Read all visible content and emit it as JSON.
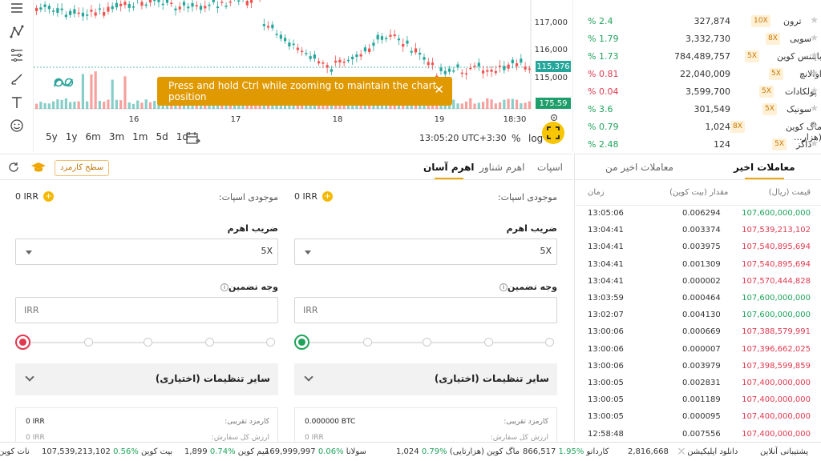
{
  "chart": {
    "y_ticks": [
      "117,000",
      "116,000",
      "115,000"
    ],
    "x_ticks": [
      "16",
      "17",
      "18",
      "19",
      "18:30"
    ],
    "last_price": "115,376",
    "volume_value": "175.59",
    "toast": "Press and hold Ctrl while zooming to maintain the chart position",
    "toast_close": "✕",
    "timeframes": [
      "5y",
      "1y",
      "6m",
      "3m",
      "1m",
      "5d",
      "1d"
    ],
    "clock": "13:05:20 UTC+3:30",
    "percent_toggle": "%",
    "log_toggle": "log",
    "colors": {
      "up": "#26a69a",
      "down": "#ef5350",
      "toast": "#e09a00",
      "accent": "#f7c600"
    }
  },
  "market_list": [
    {
      "change": "% 2.4",
      "price": "327,874",
      "leverage": "10X",
      "name": "ترون",
      "dir": "up"
    },
    {
      "change": "% 1.79",
      "price": "3,332,730",
      "leverage": "8X",
      "name": "سویی",
      "dir": "up"
    },
    {
      "change": "% 1.73",
      "price": "784,489,757",
      "leverage": "5X",
      "name": "بایننس کوین",
      "dir": "up"
    },
    {
      "change": "% 0.81",
      "price": "22,040,009",
      "leverage": "5X",
      "name": "اوالانچ",
      "dir": "down"
    },
    {
      "change": "% 0.04",
      "price": "3,599,700",
      "leverage": "5X",
      "name": "پولکادات",
      "dir": "down"
    },
    {
      "change": "% 3.6",
      "price": "301,549",
      "leverage": "5X",
      "name": "سونیک",
      "dir": "up"
    },
    {
      "change": "% 0.79",
      "price": "1,024",
      "leverage": "8X",
      "name": "ماگ کوین (هزار...",
      "dir": "up"
    },
    {
      "change": "% 2.48",
      "price": "124",
      "leverage": "5X",
      "name": "داگز",
      "dir": "up"
    }
  ],
  "trade_panel": {
    "tabs": [
      "اسپات",
      "اهرم شناور",
      "اهرم آسان"
    ],
    "fee_level": "سطح کارمزد",
    "spot_balance_label": "موجودی اسپات:",
    "spot_balance_value": "0 IRR",
    "leverage_label": "ضریب اهرم",
    "leverage_value": "5X",
    "margin_label": "وجه تضمین",
    "margin_placeholder": "IRR",
    "optional_settings": "سایر تنظیمات (اختیاری)",
    "fee_approx_label": "کارمزد تقریبی:",
    "buy_fee_value": "0.000000 BTC",
    "sell_fee_value": "0 IRR",
    "row2_label": "ارزش کل سفارش:",
    "row2_value": "0 IRR",
    "slider_percent": 0
  },
  "trades": {
    "tabs": [
      "معاملات اخیر",
      "معاملات اخیر من"
    ],
    "headers": {
      "price": "قیمت (ریال)",
      "amount": "مقدار (بیت کوین)",
      "time": "زمان"
    },
    "rows": [
      {
        "time": "13:05:06",
        "amount": "0.006294",
        "price": "107,600,000,000",
        "dir": "up"
      },
      {
        "time": "13:04:41",
        "amount": "0.003374",
        "price": "107,539,213,102",
        "dir": "down"
      },
      {
        "time": "13:04:41",
        "amount": "0.003975",
        "price": "107,540,895,694",
        "dir": "down"
      },
      {
        "time": "13:04:41",
        "amount": "0.001309",
        "price": "107,540,895,694",
        "dir": "down"
      },
      {
        "time": "13:04:41",
        "amount": "0.000002",
        "price": "107,570,444,828",
        "dir": "down"
      },
      {
        "time": "13:03:59",
        "amount": "0.000464",
        "price": "107,600,000,000",
        "dir": "up"
      },
      {
        "time": "13:02:07",
        "amount": "0.004130",
        "price": "107,600,000,000",
        "dir": "up"
      },
      {
        "time": "13:00:06",
        "amount": "0.000669",
        "price": "107,388,579,991",
        "dir": "down"
      },
      {
        "time": "13:00:06",
        "amount": "0.000007",
        "price": "107,396,662,025",
        "dir": "down"
      },
      {
        "time": "13:00:06",
        "amount": "0.003979",
        "price": "107,398,599,859",
        "dir": "down"
      },
      {
        "time": "13:00:05",
        "amount": "0.002831",
        "price": "107,400,000,000",
        "dir": "down"
      },
      {
        "time": "13:00:05",
        "amount": "0.001189",
        "price": "107,400,000,000",
        "dir": "down"
      },
      {
        "time": "13:00:05",
        "amount": "0.000095",
        "price": "107,400,000,000",
        "dir": "down"
      },
      {
        "time": "12:58:48",
        "amount": "0.007556",
        "price": "107,400,000,000",
        "dir": "down"
      }
    ]
  },
  "ticker": [
    {
      "name": "نات کوین",
      "price": "",
      "change": "",
      "dir": "up"
    },
    {
      "name": "بیت کوین",
      "price": "107,539,213,102",
      "change": "0.56%",
      "dir": "up"
    },
    {
      "name": "میم کوین",
      "price": "1,899",
      "change": "0.74%",
      "dir": "up"
    },
    {
      "name": "سولانا",
      "price": "169,999,997",
      "change": "0.06%",
      "dir": "up"
    },
    {
      "name": "ماگ کوین (هزارتایی)",
      "price": "1,024",
      "change": "0.79%",
      "dir": "up"
    },
    {
      "name": "کاردانو",
      "price": "866,517",
      "change": "1.95%",
      "dir": "up"
    },
    {
      "name": "",
      "price": "2,816,668",
      "change": "",
      "dir": "up"
    },
    {
      "name": "دانلود اپلیکیشن",
      "price": "",
      "change": "",
      "dir": "none"
    },
    {
      "name": "پشتیبانی آنلاین",
      "price": "",
      "change": "",
      "dir": "none"
    }
  ]
}
